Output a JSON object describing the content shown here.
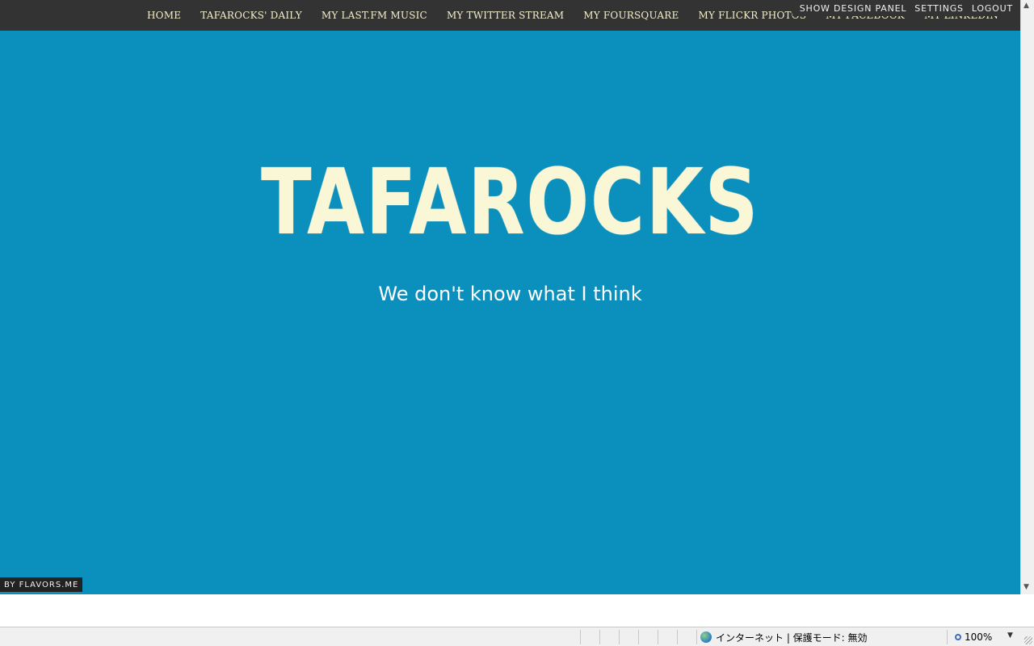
{
  "nav": {
    "items": [
      {
        "label": "HOME"
      },
      {
        "label": "TAFAROCKS' DAILY"
      },
      {
        "label": "MY LAST.FM MUSIC"
      },
      {
        "label": "MY TWITTER STREAM"
      },
      {
        "label": "MY FOURSQUARE"
      },
      {
        "label": "MY FLICKR PHOTOS"
      },
      {
        "label": "MY FACEBOOK"
      },
      {
        "label": "MY LINKEDIN"
      }
    ]
  },
  "admin": {
    "show_design_panel": "SHOW DESIGN PANEL",
    "settings": "SETTINGS",
    "logout": "LOGOUT"
  },
  "hero": {
    "logo_text": "TAFAROCKS",
    "tagline": "We don't know what I think"
  },
  "footer": {
    "credit": "BY FLAVORS.ME"
  },
  "statusbar": {
    "zone_text": "インターネット | 保護モード: 無効",
    "zoom": "100%",
    "zone_icon": "globe-icon",
    "zoom_icon": "magnifier-icon"
  },
  "colors": {
    "background": "#0b8fbd",
    "navbar": "#333333",
    "nav_text": "#f3efcc",
    "logo": "#faf7d7"
  }
}
